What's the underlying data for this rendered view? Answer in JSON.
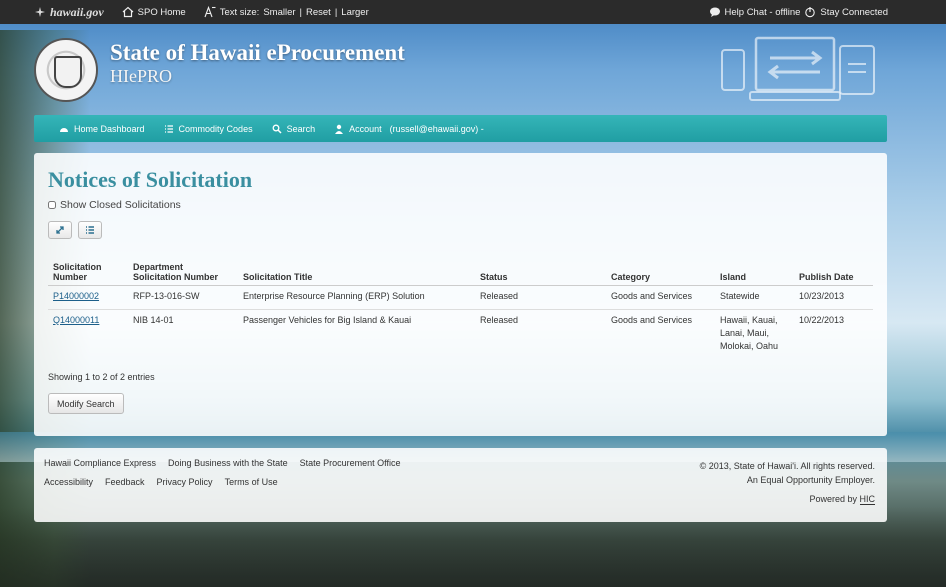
{
  "topbar": {
    "logo": "hawaii.gov",
    "spo_home": "SPO Home",
    "text_size_label": "Text size:",
    "text_size_smaller": "Smaller",
    "text_size_sep1": "|",
    "text_size_reset": "Reset",
    "text_size_sep2": "|",
    "text_size_larger": "Larger",
    "help_chat": "Help Chat - offline",
    "stay_connected": "Stay Connected"
  },
  "header": {
    "title": "State of Hawaii eProcurement",
    "subtitle": "HIePRO"
  },
  "nav": {
    "items": [
      {
        "label": "Home Dashboard",
        "icon": "dashboard-icon"
      },
      {
        "label": "Commodity Codes",
        "icon": "list-icon"
      },
      {
        "label": "Search",
        "icon": "search-icon"
      },
      {
        "label": "Account",
        "icon": "user-icon"
      }
    ],
    "account_email": "(russell@ehawaii.gov) -"
  },
  "main": {
    "page_title": "Notices of Solicitation",
    "show_closed_label": "Show Closed Solicitations",
    "table": {
      "headers": [
        "Solicitation Number",
        "Department Solicitation Number",
        "Solicitation Title",
        "Status",
        "Category",
        "Island",
        "Publish Date"
      ],
      "rows": [
        [
          "P14000002",
          "RFP-13-016-SW",
          "Enterprise Resource Planning (ERP) Solution",
          "Released",
          "Goods and Services",
          "Statewide",
          "10/23/2013"
        ],
        [
          "Q14000011",
          "NIB 14-01",
          "Passenger Vehicles for Big Island & Kauai",
          "Released",
          "Goods and Services",
          "Hawaii, Kauai, Lanai, Maui, Molokai, Oahu",
          "10/22/2013"
        ]
      ]
    },
    "showing_text": "Showing 1 to 2 of 2 entries",
    "modify_search_label": "Modify Search"
  },
  "footer": {
    "links1": [
      "Hawaii Compliance Express",
      "Doing Business with the State",
      "State Procurement Office"
    ],
    "links2": [
      "Accessibility",
      "Feedback",
      "Privacy Policy",
      "Terms of Use"
    ],
    "copyright": "© 2013, State of Hawai'i. All rights reserved.",
    "equal_opportunity": "An Equal Opportunity Employer.",
    "powered_by": "Powered by",
    "powered_by_name": "HIC"
  }
}
